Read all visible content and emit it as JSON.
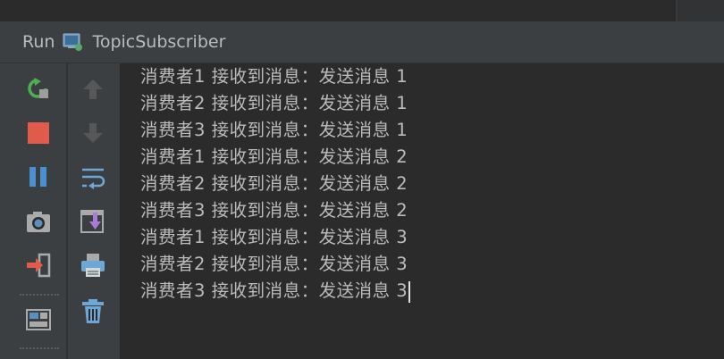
{
  "header": {
    "run_label": "Run",
    "config_name": "TopicSubscriber"
  },
  "left_toolbar": [
    {
      "name": "rerun",
      "icon": "rerun-icon"
    },
    {
      "name": "stop",
      "icon": "stop-icon"
    },
    {
      "name": "pause",
      "icon": "pause-icon"
    },
    {
      "name": "dump-threads",
      "icon": "camera-icon"
    },
    {
      "name": "exit",
      "icon": "exit-icon"
    },
    {
      "name": "layout",
      "icon": "layout-icon"
    }
  ],
  "second_toolbar": [
    {
      "name": "up-stack-trace",
      "icon": "arrow-up-icon"
    },
    {
      "name": "down-stack-trace",
      "icon": "arrow-down-icon"
    },
    {
      "name": "soft-wrap",
      "icon": "soft-wrap-icon"
    },
    {
      "name": "scroll-to-end",
      "icon": "scroll-to-end-icon"
    },
    {
      "name": "print",
      "icon": "print-icon"
    },
    {
      "name": "clear-all",
      "icon": "trash-icon"
    }
  ],
  "console": {
    "lines": [
      "消费者1 接收到消息：发送消息 1",
      "消费者2 接收到消息：发送消息 1",
      "消费者3 接收到消息：发送消息 1",
      "消费者1 接收到消息：发送消息 2",
      "消费者2 接收到消息：发送消息 2",
      "消费者3 接收到消息：发送消息 2",
      "消费者1 接收到消息：发送消息 3",
      "消费者2 接收到消息：发送消息 3",
      "消费者3 接收到消息：发送消息 3"
    ]
  },
  "colors": {
    "background": "#2b2b2b",
    "panel": "#3c3f41",
    "text": "#bbbbbb",
    "stop_red": "#e05b4a",
    "pause_blue": "#4a8fd0",
    "rerun_green": "#4caf50"
  }
}
